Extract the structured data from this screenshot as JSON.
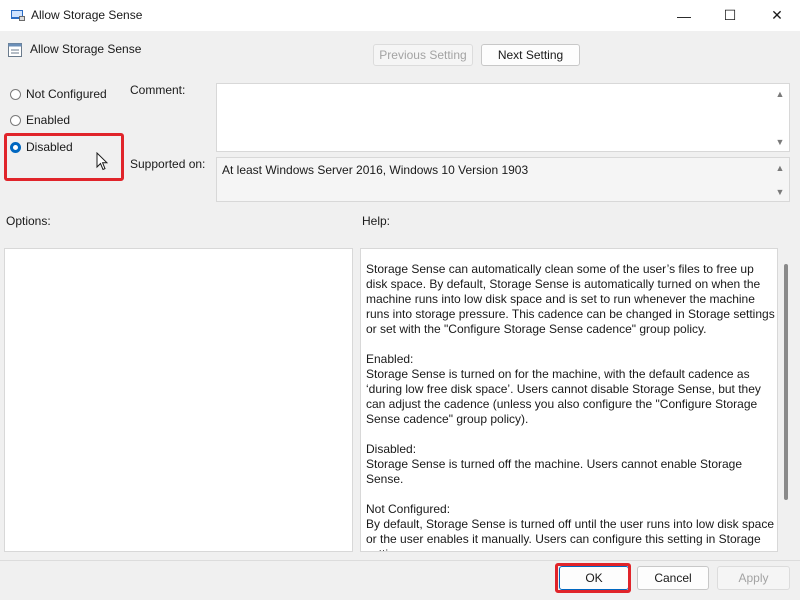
{
  "window": {
    "title": "Allow Storage Sense",
    "controls": {
      "minimize": "—",
      "maximize": "☐",
      "close": "✕"
    }
  },
  "header": {
    "policy_name": "Allow Storage Sense",
    "previous_label": "Previous Setting",
    "next_label": "Next Setting"
  },
  "state": {
    "options": [
      {
        "label": "Not Configured",
        "checked": false
      },
      {
        "label": "Enabled",
        "checked": false
      },
      {
        "label": "Disabled",
        "checked": true
      }
    ]
  },
  "comment": {
    "label": "Comment:",
    "value": ""
  },
  "supported": {
    "label": "Supported on:",
    "value": "At least Windows Server 2016, Windows 10 Version 1903"
  },
  "options_label": "Options:",
  "help_label": "Help:",
  "help_text": "Storage Sense can automatically clean some of the user’s files to free up disk space. By default, Storage Sense is automatically turned on when the machine runs into low disk space and is set to run whenever the machine runs into storage pressure. This cadence can be changed in Storage settings or set with the \"Configure Storage Sense cadence\" group policy.\n\nEnabled:\nStorage Sense is turned on for the machine, with the default cadence as ‘during low free disk space’. Users cannot disable Storage Sense, but they can adjust the cadence (unless you also configure the \"Configure Storage Sense cadence\" group policy).\n\nDisabled:\nStorage Sense is turned off the machine. Users cannot enable Storage Sense.\n\nNot Configured:\nBy default, Storage Sense is turned off until the user runs into low disk space or the user enables it manually. Users can configure this setting in Storage settings.",
  "footer": {
    "ok_label": "OK",
    "cancel_label": "Cancel",
    "apply_label": "Apply"
  },
  "colors": {
    "accent": "#0067c0",
    "highlight": "#e0242a"
  }
}
